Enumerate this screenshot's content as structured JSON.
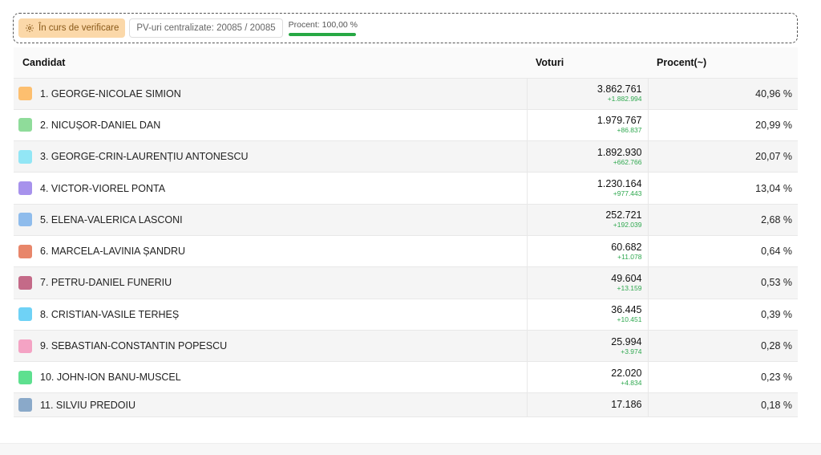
{
  "status": {
    "verify_label": "În curs de verificare",
    "pv_label": "PV-uri centralizate: 20085 / 20085",
    "progress_label": "Procent: 100,00 %",
    "progress_value": 100,
    "progress_color": "#27a844"
  },
  "table": {
    "headers": {
      "candidate": "Candidat",
      "votes": "Voturi",
      "percent": "Procent(~)"
    },
    "rows": [
      {
        "name": "1. GEORGE-NICOLAE SIMION",
        "votes": "3.862.761",
        "delta": "+1.882.994",
        "percent": "40,96 %",
        "color": "#fdbf6f"
      },
      {
        "name": "2. NICUȘOR-DANIEL DAN",
        "votes": "1.979.767",
        "delta": "+86.837",
        "percent": "20,99 %",
        "color": "#8fdc9a"
      },
      {
        "name": "3. GEORGE-CRIN-LAURENȚIU ANTONESCU",
        "votes": "1.892.930",
        "delta": "+662.766",
        "percent": "20,07 %",
        "color": "#92e6f5"
      },
      {
        "name": "4. VICTOR-VIOREL PONTA",
        "votes": "1.230.164",
        "delta": "+977.443",
        "percent": "13,04 %",
        "color": "#a792ec"
      },
      {
        "name": "5. ELENA-VALERICA LASCONI",
        "votes": "252.721",
        "delta": "+192.039",
        "percent": "2,68 %",
        "color": "#8fbcec"
      },
      {
        "name": "6. MARCELA-LAVINIA ȘANDRU",
        "votes": "60.682",
        "delta": "+11.078",
        "percent": "0,64 %",
        "color": "#e8866a"
      },
      {
        "name": "7. PETRU-DANIEL FUNERIU",
        "votes": "49.604",
        "delta": "+13.159",
        "percent": "0,53 %",
        "color": "#c46a88"
      },
      {
        "name": "8. CRISTIAN-VASILE TERHEȘ",
        "votes": "36.445",
        "delta": "+10.451",
        "percent": "0,39 %",
        "color": "#6fd2f6"
      },
      {
        "name": "9. SEBASTIAN-CONSTANTIN POPESCU",
        "votes": "25.994",
        "delta": "+3.974",
        "percent": "0,28 %",
        "color": "#f4a3c4"
      },
      {
        "name": "10. JOHN-ION BANU-MUSCEL",
        "votes": "22.020",
        "delta": "+4.834",
        "percent": "0,23 %",
        "color": "#5ee08f"
      },
      {
        "name": "11. SILVIU PREDOIU",
        "votes": "17.186",
        "delta": "",
        "percent": "0,18 %",
        "color": "#8aa9c9"
      }
    ]
  }
}
